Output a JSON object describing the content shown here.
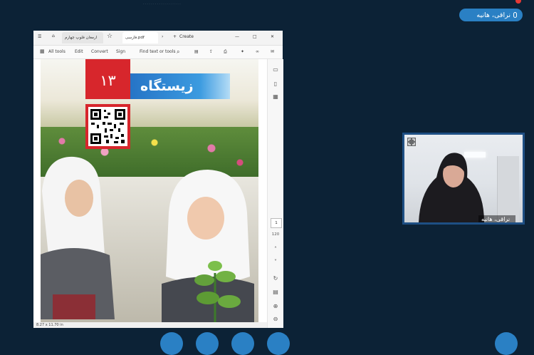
{
  "header": {
    "top_text": "...................",
    "presenter_name": "نراقی، هانیه"
  },
  "share_window": {
    "titlebar": {
      "tab_left": "ارمغان فلوپ چهارم",
      "tab_active": "فارسی.pdf",
      "create_label": "Create",
      "minimize": "—",
      "maximize": "□",
      "close": "✕"
    },
    "toolbar": {
      "all_tools": "All tools",
      "edit": "Edit",
      "convert": "Convert",
      "sign": "Sign",
      "find": "Find text or tools"
    },
    "page_current": "1",
    "page_total": "120",
    "status": "8.27 x 11.70 in",
    "document": {
      "lesson_number": "۱۳",
      "lesson_title": "زیستگاه"
    }
  },
  "camera": {
    "name_label": "نراقی، هانیه"
  },
  "colors": {
    "background": "#0c2236",
    "accent": "#2a80c4",
    "banner_red": "#d7262c",
    "banner_blue": "#2674c6"
  }
}
